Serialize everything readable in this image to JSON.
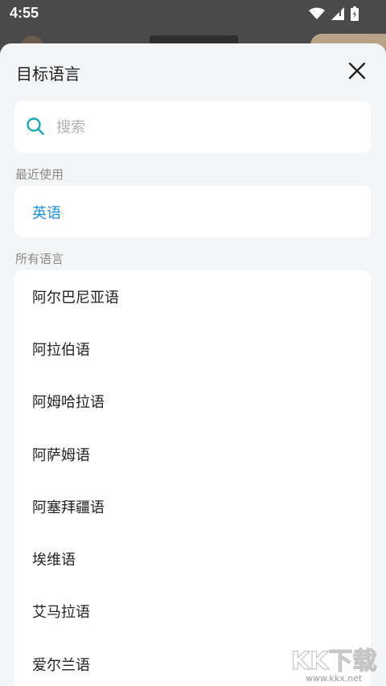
{
  "status_bar": {
    "time": "4:55",
    "icons": [
      "wifi-icon",
      "signal-icon",
      "battery-icon"
    ]
  },
  "sheet": {
    "title": "目标语言",
    "search": {
      "placeholder": "搜索",
      "value": ""
    },
    "recent_label": "最近使用",
    "recent_items": [
      "英语"
    ],
    "all_label": "所有语言",
    "languages": [
      "阿尔巴尼亚语",
      "阿拉伯语",
      "阿姆哈拉语",
      "阿萨姆语",
      "阿塞拜疆语",
      "埃维语",
      "艾马拉语",
      "爱尔兰语"
    ]
  },
  "watermark": {
    "logo_text": "KK下载",
    "url": "www.kkx.net"
  },
  "colors": {
    "accent": "#1a8fe3",
    "search_icon": "#1aa7b5",
    "sheet_bg": "#f4f5f7"
  }
}
